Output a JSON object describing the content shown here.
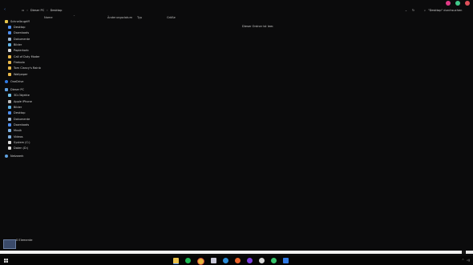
{
  "colors": {
    "accent": "#4d8ef0",
    "folder": "#e9b94a",
    "onedrive": "#2f7ae5"
  },
  "toolbar": {
    "back_icon": "back-arrow-icon",
    "crumbs": [
      "Dieser PC",
      "Desktop"
    ],
    "search_placeholder": "\"Desktop\" durchsuchen"
  },
  "columns": [
    "Name",
    "Änderungsdatum",
    "Typ",
    "Größe"
  ],
  "empty_message": "Dieser Ordner ist leer.",
  "nav": {
    "quick_access": {
      "title": "Schnellzugriff",
      "items": [
        "Desktop",
        "Downloads",
        "Dokumente",
        "Bilder",
        "Papierkorb",
        "Call of Duty  Moder",
        "Firebolo",
        "Tom Clancy's Rainb",
        "Wallpaper"
      ]
    },
    "onedrive": "OneDrive",
    "this_pc": {
      "title": "Dieser PC",
      "items": [
        "3D-Objekte",
        "Apple iPhone",
        "Bilder",
        "Desktop",
        "Dokumente",
        "Downloads",
        "Musik",
        "Videos",
        "System (C:)",
        "Daten (D:)"
      ]
    },
    "network": "Netzwerk"
  },
  "status": {
    "count": "0 Elemente"
  }
}
